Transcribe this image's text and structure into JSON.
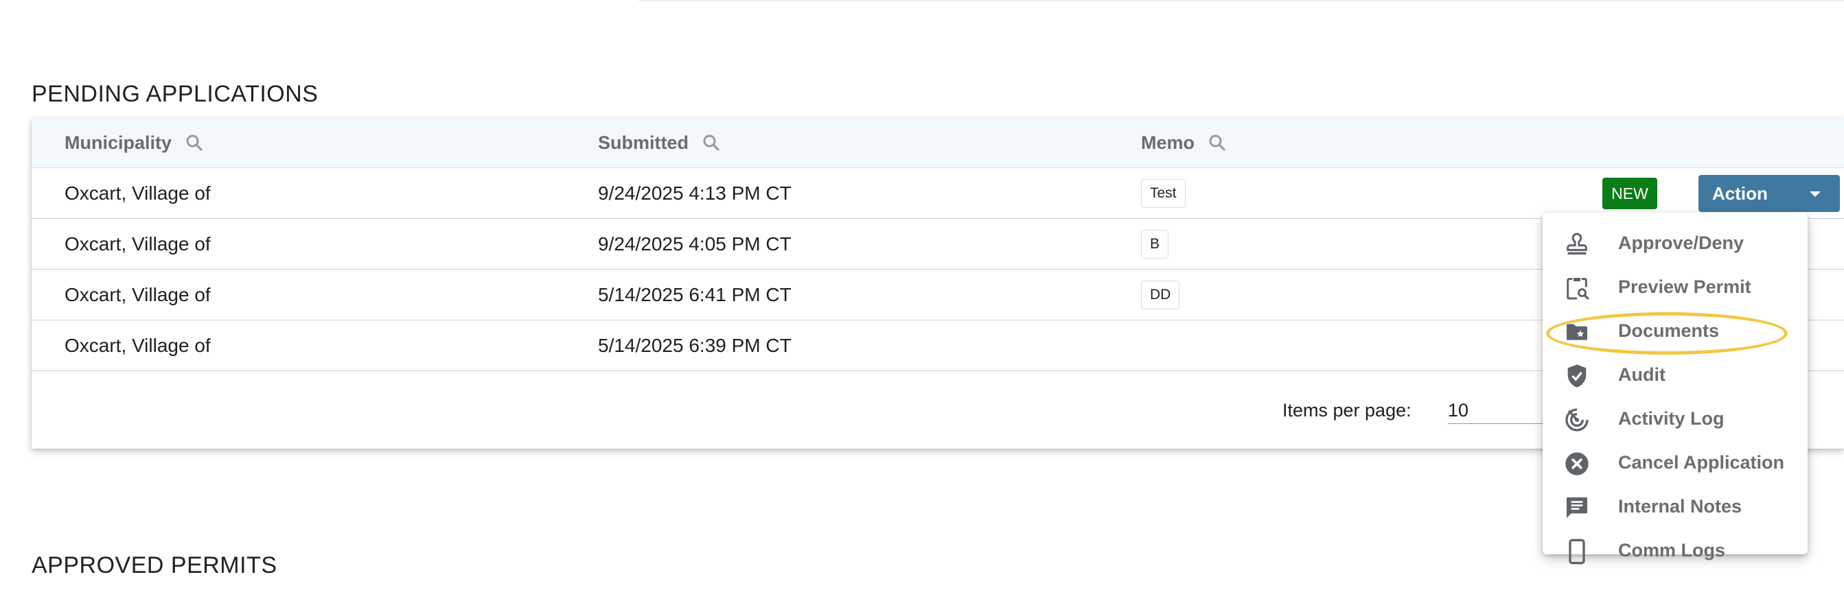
{
  "sections": {
    "pending_title": "PENDING APPLICATIONS",
    "approved_title": "APPROVED PERMITS"
  },
  "table": {
    "columns": [
      "Municipality",
      "Submitted",
      "Memo"
    ],
    "rows": [
      {
        "municipality": "Oxcart, Village of",
        "submitted": "9/24/2025 4:13 PM CT",
        "memo": "Test"
      },
      {
        "municipality": "Oxcart, Village of",
        "submitted": "9/24/2025 4:05 PM CT",
        "memo": "B"
      },
      {
        "municipality": "Oxcart, Village of",
        "submitted": "5/14/2025 6:41 PM CT",
        "memo": "DD"
      },
      {
        "municipality": "Oxcart, Village of",
        "submitted": "5/14/2025 6:39 PM CT",
        "memo": ""
      }
    ],
    "new_badge": "NEW",
    "action_label": "Action"
  },
  "paginator": {
    "items_per_page_label": "Items per page:",
    "items_per_page_value": "10"
  },
  "menu": {
    "items": [
      {
        "label": "Approve/Deny",
        "icon": "stamp-icon"
      },
      {
        "label": "Preview Permit",
        "icon": "clipboard-search-icon"
      },
      {
        "label": "Documents",
        "icon": "folder-star-icon"
      },
      {
        "label": "Audit",
        "icon": "shield-check-icon"
      },
      {
        "label": "Activity Log",
        "icon": "activity-icon"
      },
      {
        "label": "Cancel Application",
        "icon": "cancel-circle-icon"
      },
      {
        "label": "Internal Notes",
        "icon": "note-icon"
      },
      {
        "label": "Comm Logs",
        "icon": "phone-icon"
      }
    ],
    "highlighted_item": "Documents",
    "highlight_color": "#f2c744"
  },
  "colors": {
    "new_badge": "#0a7d17",
    "action_button": "#3f78a0",
    "header_bg": "#f3f8fc"
  }
}
